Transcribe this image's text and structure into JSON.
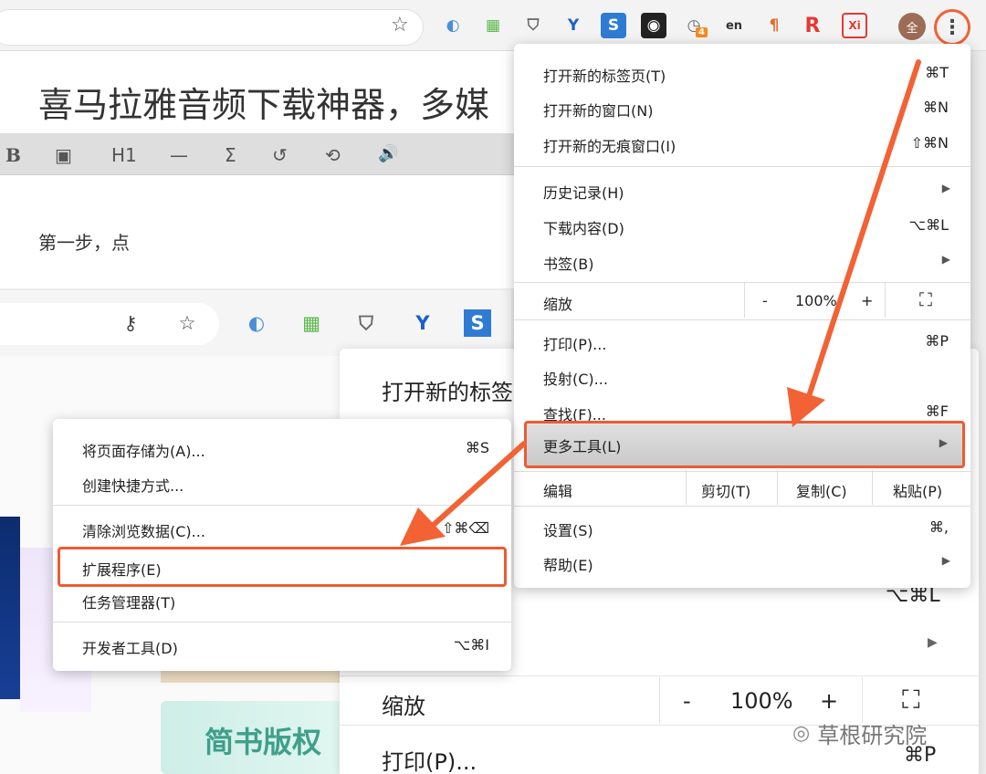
{
  "top_browser": {
    "doc_title": "喜马拉雅音频下载神器，多媒",
    "doc_text": "第一步，点",
    "toolbar": {
      "bold": "B",
      "image": "▣",
      "h1": "H1",
      "hr": "—",
      "sigma": "Σ",
      "undo": "↺",
      "history": "⟲",
      "audio": "🔊"
    },
    "ext_badge": "4",
    "ext_en": "en",
    "ext_r": "R",
    "ext_xi": "Xi",
    "avatar": "全",
    "menu_dots": "⋮"
  },
  "main_menu": {
    "items": [
      {
        "label": "打开新的标签页(T)",
        "shortcut": "⌘T"
      },
      {
        "label": "打开新的窗口(N)",
        "shortcut": "⌘N"
      },
      {
        "label": "打开新的无痕窗口(I)",
        "shortcut": "⇧⌘N"
      },
      {
        "label": "历史记录(H)"
      },
      {
        "label": "下载内容(D)",
        "shortcut": "⌥⌘L"
      },
      {
        "label": "书签(B)"
      },
      {
        "label": "缩放",
        "zoom_minus": "-",
        "zoom_value": "100%",
        "zoom_plus": "+",
        "fullscreen": "⛶"
      },
      {
        "label": "打印(P)...",
        "shortcut": "⌘P"
      },
      {
        "label": "投射(C)..."
      },
      {
        "label": "查找(F)...",
        "shortcut": "⌘F"
      },
      {
        "label": "更多工具(L)"
      },
      {
        "label": "编辑",
        "cut": "剪切(T)",
        "copy": "复制(C)",
        "paste": "粘贴(P)"
      },
      {
        "label": "设置(S)",
        "shortcut": "⌘,"
      },
      {
        "label": "帮助(E)"
      }
    ]
  },
  "sub_menu": {
    "items": [
      {
        "label": "将页面存储为(A)...",
        "shortcut": "⌘S"
      },
      {
        "label": "创建快捷方式..."
      },
      {
        "label": "清除浏览数据(C)...",
        "shortcut": "⇧⌘⌫"
      },
      {
        "label": "扩展程序(E)"
      },
      {
        "label": "任务管理器(T)"
      },
      {
        "label": "开发者工具(D)",
        "shortcut": "⌥⌘I"
      }
    ]
  },
  "background_menu": {
    "new_tab_partial": "打开新的标签",
    "download_shortcut": "⌥⌘L",
    "arrow": "▶",
    "zoom_label": "缩放",
    "zoom_minus": "-",
    "zoom_value": "100%",
    "zoom_plus": "+",
    "fullscreen": "⛶",
    "print_label": "打印(P)...",
    "print_shortcut": "⌘P"
  },
  "background_page": {
    "card_text": "简书版权"
  },
  "watermark": {
    "text": "草根研究院"
  },
  "colors": {
    "highlight": "#ef5a33",
    "arrow": "#f26234"
  }
}
